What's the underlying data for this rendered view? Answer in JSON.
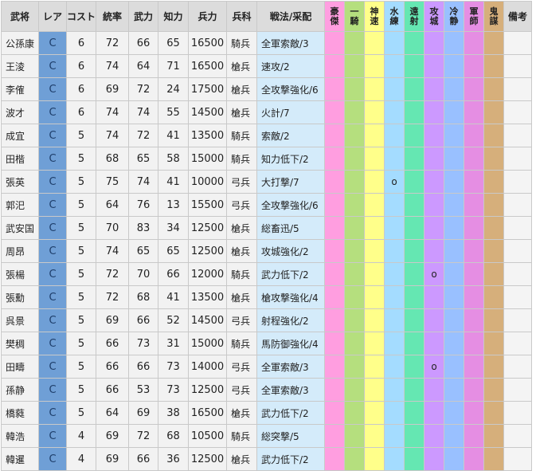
{
  "colors": {
    "rarity": "#6f9fd6",
    "tactic": "#d4ebfa",
    "skills": [
      "#ff9ee0",
      "#b5df7e",
      "#ffff8a",
      "#a4dcff",
      "#65e7b2",
      "#cc99ff",
      "#99c0ff",
      "#e58ee3",
      "#d6af7b"
    ]
  },
  "headers": {
    "name": "武将",
    "rarity": "レア",
    "cost": "コスト",
    "lead": "統率",
    "power": "武力",
    "intel": "知力",
    "troops": "兵力",
    "type": "兵科",
    "tactic": "戦法/采配",
    "note": "備考",
    "skills": [
      [
        "豪",
        "傑"
      ],
      [
        "一",
        "騎"
      ],
      [
        "神",
        "速"
      ],
      [
        "水",
        "練"
      ],
      [
        "遠",
        "射"
      ],
      [
        "攻",
        "城"
      ],
      [
        "冷",
        "静"
      ],
      [
        "軍",
        "師"
      ],
      [
        "鬼",
        "謀"
      ]
    ]
  },
  "rows": [
    {
      "name": "公孫康",
      "rarity": "C",
      "cost": "6",
      "lead": "72",
      "power": "66",
      "intel": "65",
      "troops": "16500",
      "type": "騎兵",
      "tactic": "全軍索敵/3",
      "skills": [
        "",
        "",
        "",
        "",
        "",
        "",
        "",
        "",
        ""
      ]
    },
    {
      "name": "王淩",
      "rarity": "C",
      "cost": "6",
      "lead": "74",
      "power": "64",
      "intel": "71",
      "troops": "16500",
      "type": "槍兵",
      "tactic": "速攻/2",
      "skills": [
        "",
        "",
        "",
        "",
        "",
        "",
        "",
        "",
        ""
      ]
    },
    {
      "name": "李傕",
      "rarity": "C",
      "cost": "6",
      "lead": "69",
      "power": "72",
      "intel": "24",
      "troops": "17500",
      "type": "槍兵",
      "tactic": "全攻撃強化/6",
      "skills": [
        "",
        "",
        "",
        "",
        "",
        "",
        "",
        "",
        ""
      ]
    },
    {
      "name": "波才",
      "rarity": "C",
      "cost": "6",
      "lead": "74",
      "power": "74",
      "intel": "55",
      "troops": "14500",
      "type": "槍兵",
      "tactic": "火計/7",
      "skills": [
        "",
        "",
        "",
        "",
        "",
        "",
        "",
        "",
        ""
      ]
    },
    {
      "name": "成宜",
      "rarity": "C",
      "cost": "5",
      "lead": "74",
      "power": "72",
      "intel": "41",
      "troops": "13500",
      "type": "騎兵",
      "tactic": "索敵/2",
      "skills": [
        "",
        "",
        "",
        "",
        "",
        "",
        "",
        "",
        ""
      ]
    },
    {
      "name": "田楷",
      "rarity": "C",
      "cost": "5",
      "lead": "68",
      "power": "65",
      "intel": "58",
      "troops": "15000",
      "type": "騎兵",
      "tactic": "知力低下/2",
      "skills": [
        "",
        "",
        "",
        "",
        "",
        "",
        "",
        "",
        ""
      ]
    },
    {
      "name": "張英",
      "rarity": "C",
      "cost": "5",
      "lead": "75",
      "power": "74",
      "intel": "41",
      "troops": "10000",
      "type": "弓兵",
      "tactic": "大打撃/7",
      "skills": [
        "",
        "",
        "",
        "o",
        "",
        "",
        "",
        "",
        ""
      ]
    },
    {
      "name": "郭汜",
      "rarity": "C",
      "cost": "5",
      "lead": "64",
      "power": "76",
      "intel": "13",
      "troops": "15500",
      "type": "弓兵",
      "tactic": "全攻撃強化/6",
      "skills": [
        "",
        "",
        "",
        "",
        "",
        "",
        "",
        "",
        ""
      ]
    },
    {
      "name": "武安国",
      "rarity": "C",
      "cost": "5",
      "lead": "70",
      "power": "83",
      "intel": "34",
      "troops": "12500",
      "type": "槍兵",
      "tactic": "総畜迅/5",
      "skills": [
        "",
        "",
        "",
        "",
        "",
        "",
        "",
        "",
        ""
      ]
    },
    {
      "name": "周昂",
      "rarity": "C",
      "cost": "5",
      "lead": "74",
      "power": "65",
      "intel": "65",
      "troops": "12500",
      "type": "槍兵",
      "tactic": "攻城強化/2",
      "skills": [
        "",
        "",
        "",
        "",
        "",
        "",
        "",
        "",
        ""
      ]
    },
    {
      "name": "張楊",
      "rarity": "C",
      "cost": "5",
      "lead": "72",
      "power": "70",
      "intel": "66",
      "troops": "12000",
      "type": "騎兵",
      "tactic": "武力低下/2",
      "skills": [
        "",
        "",
        "",
        "",
        "",
        "o",
        "",
        "",
        ""
      ]
    },
    {
      "name": "張勳",
      "rarity": "C",
      "cost": "5",
      "lead": "72",
      "power": "68",
      "intel": "41",
      "troops": "13500",
      "type": "槍兵",
      "tactic": "槍攻撃強化/4",
      "skills": [
        "",
        "",
        "",
        "",
        "",
        "",
        "",
        "",
        ""
      ]
    },
    {
      "name": "呉景",
      "rarity": "C",
      "cost": "5",
      "lead": "69",
      "power": "66",
      "intel": "52",
      "troops": "14500",
      "type": "弓兵",
      "tactic": "射程強化/2",
      "skills": [
        "",
        "",
        "",
        "",
        "",
        "",
        "",
        "",
        ""
      ]
    },
    {
      "name": "樊稠",
      "rarity": "C",
      "cost": "5",
      "lead": "66",
      "power": "73",
      "intel": "31",
      "troops": "15000",
      "type": "騎兵",
      "tactic": "馬防御強化/4",
      "skills": [
        "",
        "",
        "",
        "",
        "",
        "",
        "",
        "",
        ""
      ]
    },
    {
      "name": "田疇",
      "rarity": "C",
      "cost": "5",
      "lead": "66",
      "power": "66",
      "intel": "73",
      "troops": "14000",
      "type": "弓兵",
      "tactic": "全軍索敵/3",
      "skills": [
        "",
        "",
        "",
        "",
        "",
        "o",
        "",
        "",
        ""
      ]
    },
    {
      "name": "孫静",
      "rarity": "C",
      "cost": "5",
      "lead": "66",
      "power": "53",
      "intel": "73",
      "troops": "12500",
      "type": "弓兵",
      "tactic": "全軍索敵/3",
      "skills": [
        "",
        "",
        "",
        "",
        "",
        "",
        "",
        "",
        ""
      ]
    },
    {
      "name": "橋蕤",
      "rarity": "C",
      "cost": "5",
      "lead": "64",
      "power": "69",
      "intel": "38",
      "troops": "16500",
      "type": "槍兵",
      "tactic": "武力低下/2",
      "skills": [
        "",
        "",
        "",
        "",
        "",
        "",
        "",
        "",
        ""
      ]
    },
    {
      "name": "韓浩",
      "rarity": "C",
      "cost": "4",
      "lead": "69",
      "power": "72",
      "intel": "68",
      "troops": "10500",
      "type": "騎兵",
      "tactic": "総突撃/5",
      "skills": [
        "",
        "",
        "",
        "",
        "",
        "",
        "",
        "",
        ""
      ]
    },
    {
      "name": "韓暹",
      "rarity": "C",
      "cost": "4",
      "lead": "69",
      "power": "66",
      "intel": "36",
      "troops": "12500",
      "type": "槍兵",
      "tactic": "武力低下/2",
      "skills": [
        "",
        "",
        "",
        "",
        "",
        "",
        "",
        "",
        ""
      ]
    }
  ]
}
